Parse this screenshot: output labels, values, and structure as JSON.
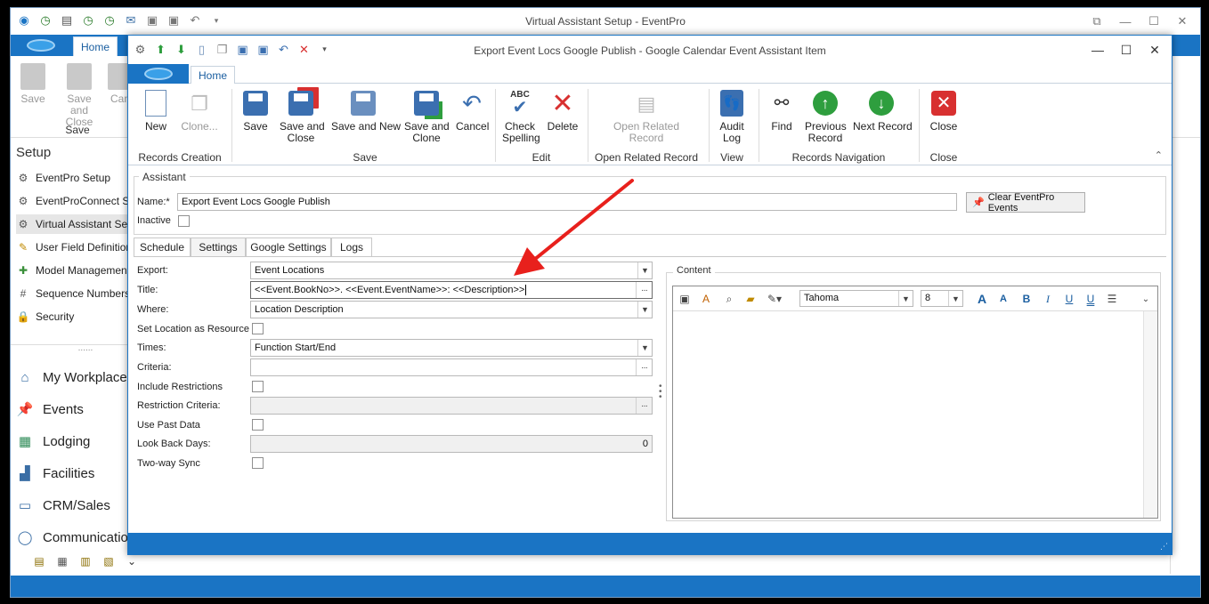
{
  "main": {
    "title": "Virtual Assistant Setup - EventPro",
    "home_tab": "Home",
    "ribbon": {
      "save": "Save",
      "save_close": "Save and Close",
      "cancel": "Can",
      "group": "Save"
    },
    "sidebar": {
      "title": "Setup",
      "items": [
        "EventPro Setup",
        "EventProConnect Set",
        "Virtual Assistant Setu",
        "User Field Definition",
        "Model Management",
        "Sequence Numbers",
        "Security"
      ],
      "nav": [
        "My Workplace",
        "Events",
        "Lodging",
        "Facilities",
        "CRM/Sales",
        "Communications"
      ],
      "splitter": "......"
    }
  },
  "dialog": {
    "title": "Export Event Locs Google Publish - Google Calendar Event Assistant Item",
    "home_tab": "Home",
    "ribbon": {
      "new": "New",
      "clone": "Clone...",
      "records_creation": "Records Creation",
      "save": "Save",
      "save_close_1": "Save and",
      "save_close_2": "Close",
      "save_new": "Save and New",
      "save_clone_1": "Save and",
      "save_clone_2": "Clone",
      "cancel": "Cancel",
      "save_group": "Save",
      "check_1": "Check",
      "check_2": "Spelling",
      "delete": "Delete",
      "edit_group": "Edit",
      "open_related_1": "Open Related",
      "open_related_2": "Record",
      "open_related_group": "Open Related Record",
      "audit_1": "Audit",
      "audit_2": "Log",
      "view_group": "View",
      "find": "Find",
      "prev_1": "Previous",
      "prev_2": "Record",
      "next": "Next Record",
      "nav_group": "Records Navigation",
      "close": "Close",
      "close_group": "Close",
      "abc": "ABC"
    },
    "assistant": {
      "legend": "Assistant",
      "name_label": "Name:*",
      "name_value": "Export Event Locs Google Publish",
      "inactive_label": "Inactive",
      "clear_button": "Clear EventPro Events"
    },
    "tabs": [
      "Schedule",
      "Settings",
      "Google Settings",
      "Logs"
    ],
    "settings": {
      "export_label": "Export:",
      "export_value": "Event Locations",
      "title_label": "Title:",
      "title_value": "<<Event.BookNo>>. <<Event.EventName>>: <<Description>>",
      "where_label": "Where:",
      "where_value": "Location Description",
      "set_location_label": "Set Location as Resource",
      "times_label": "Times:",
      "times_value": "Function Start/End",
      "criteria_label": "Criteria:",
      "criteria_value": "",
      "include_restrictions_label": "Include Restrictions",
      "restriction_criteria_label": "Restriction Criteria:",
      "use_past_label": "Use Past Data",
      "look_back_label": "Look Back Days:",
      "look_back_value": "0",
      "two_way_label": "Two-way Sync"
    },
    "content": {
      "legend": "Content",
      "font": "Tahoma",
      "size": "8"
    }
  },
  "colors": {
    "accent": "#1a74c4",
    "arrow": "#e8201c"
  }
}
